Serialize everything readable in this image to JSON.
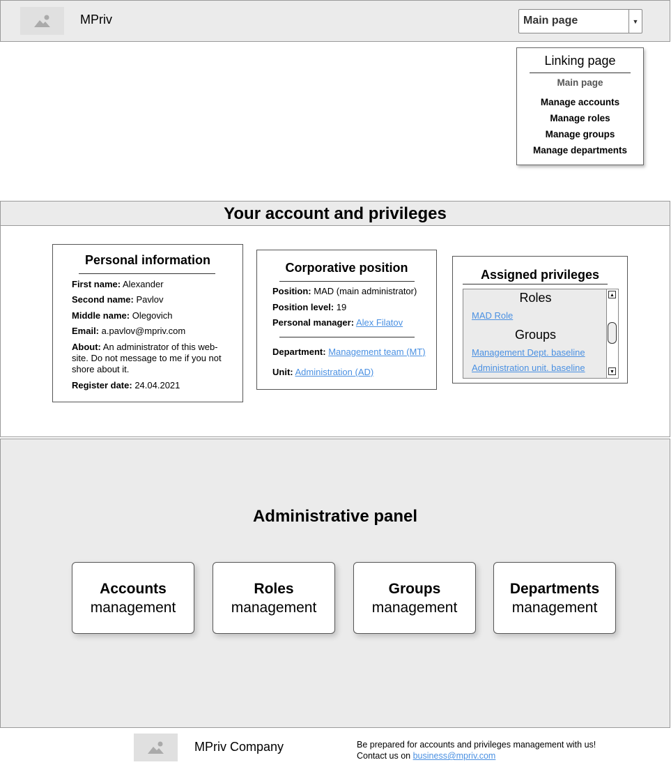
{
  "header": {
    "logo_icon": "image-placeholder-icon",
    "brand": "MPriv",
    "nav_select": {
      "selected": "Main page",
      "arrow_icon": "caret-down-icon"
    }
  },
  "linking_menu": {
    "title": "Linking page",
    "items": [
      "Main page",
      "Manage accounts",
      "Manage roles",
      "Manage groups",
      "Manage departments"
    ],
    "current_item": "Main page"
  },
  "account": {
    "title": "Your account and privileges",
    "personal": {
      "title": "Personal information",
      "first_name_label": "First name:",
      "first_name": "Alexander",
      "second_name_label": "Second name:",
      "second_name": "Pavlov",
      "middle_name_label": "Middle name:",
      "middle_name": "Olegovich",
      "email_label": "Email:",
      "email": "a.pavlov@mpriv.com",
      "about_label": "About:",
      "about_line1": "An administrator of this web-",
      "about_line2": "site. Do not message to me if you not",
      "about_line3": "shore about it.",
      "register_label": "Register date:",
      "register_date": "24.04.2021"
    },
    "corporate": {
      "title": "Corporative position",
      "position_label": "Position:",
      "position": "MAD (main administrator)",
      "level_label": "Position level:",
      "level": "19",
      "manager_label": "Personal manager:",
      "manager": "Alex Filatov",
      "department_label": "Department:",
      "department": "Management team (MT)",
      "unit_label": "Unit:",
      "unit": "Administration (AD)"
    },
    "privileges": {
      "title": "Assigned privileges",
      "roles_heading": "Roles",
      "roles": [
        "MAD Role"
      ],
      "groups_heading": "Groups",
      "groups": [
        "Management Dept. baseline",
        "Administration unit. baseline"
      ],
      "scroll_up_icon": "triangle-up-icon",
      "scroll_down_icon": "triangle-down-icon"
    }
  },
  "admin_panel": {
    "title": "Administrative panel",
    "tiles": [
      {
        "title": "Accounts",
        "subtitle": "management"
      },
      {
        "title": "Roles",
        "subtitle": "management"
      },
      {
        "title": "Groups",
        "subtitle": "management"
      },
      {
        "title": "Departments",
        "subtitle": "management"
      }
    ]
  },
  "footer": {
    "logo_icon": "image-placeholder-icon",
    "company": "MPriv Company",
    "tagline": "Be prepared for accounts and privileges management with us!",
    "contact_prefix": "Contact us on ",
    "contact_email": "business@mpriv.com"
  },
  "colors": {
    "section_bg": "#ebebeb",
    "border": "#9a9a9a",
    "link": "#4a90e2",
    "placeholder": "#e0e0e0"
  }
}
